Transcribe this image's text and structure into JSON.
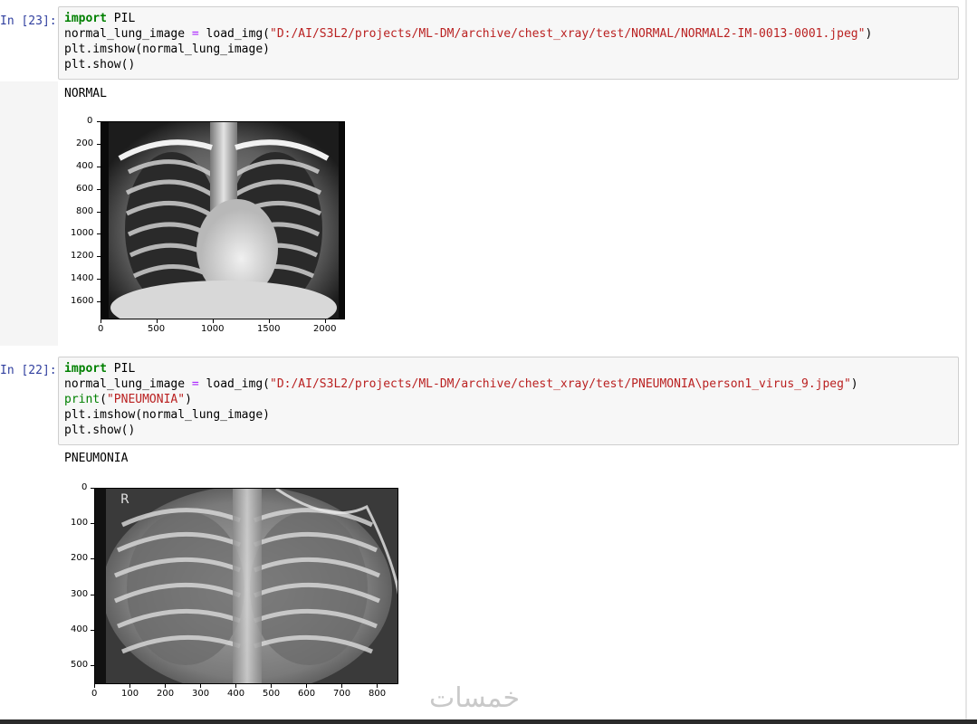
{
  "cells": [
    {
      "prompt": "In [23]:",
      "code": {
        "line1_kw": "import",
        "line1_rest": " PIL",
        "line2_var": "normal_lung_image ",
        "line2_op": "=",
        "line2_call": " load_img(",
        "line2_str": "\"D:/AI/S3L2/projects/ML-DM/archive/chest_xray/test/NORMAL/NORMAL2-IM-0013-0001.jpeg\"",
        "line2_end": ")",
        "line3": "plt.imshow(normal_lung_image)",
        "line4": "plt.show()"
      },
      "output_text": "NORMAL",
      "plot": {
        "x_ticks": [
          "0",
          "500",
          "1000",
          "1500",
          "2000"
        ],
        "y_ticks": [
          "0",
          "200",
          "400",
          "600",
          "800",
          "1000",
          "1200",
          "1400",
          "1600"
        ]
      }
    },
    {
      "prompt": "In [22]:",
      "code": {
        "line1_kw": "import",
        "line1_rest": " PIL",
        "line2_var": "normal_lung_image ",
        "line2_op": "=",
        "line2_call": " load_img(",
        "line2_str": "\"D:/AI/S3L2/projects/ML-DM/archive/chest_xray/test/PNEUMONIA\\person1_virus_9.jpeg\"",
        "line2_end": ")",
        "line3_fn": "print",
        "line3_open": "(",
        "line3_str": "\"PNEUMONIA\"",
        "line3_close": ")",
        "line4": "plt.imshow(normal_lung_image)",
        "line5": "plt.show()"
      },
      "output_text": "PNEUMONIA",
      "plot": {
        "image_label": "R",
        "x_ticks": [
          "0",
          "100",
          "200",
          "300",
          "400",
          "500",
          "600",
          "700",
          "800"
        ],
        "y_ticks": [
          "0",
          "100",
          "200",
          "300",
          "400",
          "500"
        ]
      }
    }
  ],
  "watermark": "خمسات"
}
